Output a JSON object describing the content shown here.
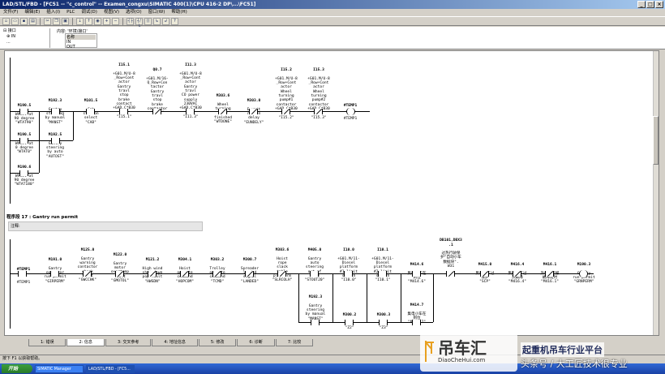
{
  "window": {
    "title": "LAD/STL/FBD - [FC51 -- \"c_control\" -- Examen_congxu\\SIMATIC 400(1)\\CPU 416-2 DP\\...\\FC51]",
    "min_label": "_",
    "max_label": "□",
    "close_label": "×"
  },
  "menu": [
    "文件(F)",
    "编辑(E)",
    "插入(I)",
    "PLC",
    "调试(D)",
    "视图(V)",
    "选项(O)",
    "窗口(W)",
    "帮助(H)"
  ],
  "declaration": {
    "tree_root": "⊟ 接口",
    "tree_in": "⊕ IN",
    "tree_more": "...",
    "path_label": "内容: '环境\\接口'",
    "name_header": "名称",
    "name_value": "IN\nOUT"
  },
  "segment16": {
    "operands": [
      {
        "addr": "M190.5",
        "text": "Wheel at\n90 degree\n\"WTAT90\""
      },
      {
        "addr": "M192.3",
        "text": "Gantry\nsteering\nby manual\n\"MANST\""
      },
      {
        "addr": "M101.5",
        "text": "Cab\nstation\nselect\n\"CAB\""
      },
      {
        "addr": "I15.1",
        "text": "+G01.M/U-8\n_Row+Cont\nactor\nGantry\ntravl\nstop\nbrake\ncontact\n+GAD.C*B30\n48\n\"I15.1\""
      },
      {
        "addr": "Q0.7",
        "text": "+G01.M/16-\nQ_Row+Con\ntactor\nGantry\ntravl\nstop\nbrake\ncontactor\n\"Q0.7\""
      },
      {
        "addr": "I11.3",
        "text": "+G01.M/U-8\n_Row+Cont\nactor\nGantry\ntravl\nCO power\nsupply\n230VAC\n+GAD.C*B30\n8\n\"I11.3\""
      },
      {
        "addr": "M303.6",
        "text": "Wheel\nturning\ntime\nfinished\n\"WTDONE\""
      },
      {
        "addr": "M303.0",
        "text": "E_unit\nrun on\ndelay\n\"EUNDELY\""
      },
      {
        "addr": "I15.2",
        "text": "+G01.M/U-8\n_Row+Cont\nactor\nWheel\nturning\npump#1\ncontactor\n+GAD.C*B30\n1\n\"I15.2\""
      },
      {
        "addr": "I15.3",
        "text": "+G01.M/U-8\n_Row+Cont\nactor\nWheel\nturning\npump#2\ncontactor\n+GAD.C*B30\n2\n\"I15.3\""
      },
      {
        "addr": "#TEMP1",
        "text": "\n#TEMP1"
      }
    ],
    "branch1": {
      "addr": "M190.5",
      "text": "Wheel at\n0 degree\n\"WTAT0\""
    },
    "branch1b": {
      "addr": "M192.5",
      "text": "Gantry\nsteering\nby auto\n\"AUTOST\""
    },
    "branch2": {
      "addr": "M190.6",
      "text": "Wheel at\n90 degree\n\"WTAT180\""
    }
  },
  "segment17": {
    "title": "程序段 17 : Gantry run permit",
    "comment": "注释:",
    "operands": [
      {
        "addr": "#TEMP1",
        "text": "\n#TEMP1"
      },
      {
        "addr": "M191.0",
        "text": "Gantry\noperator\nrun permit\n\"GIRPERM\""
      },
      {
        "addr": "M125.0",
        "text": "Gantry\nwarning\ncontactor\ncheck\nfault\n\"GWCCHK\""
      },
      {
        "addr": "M122.0",
        "text": "Gantry\nmotor\novertemp\nfault\n\"GMOTOL\""
      },
      {
        "addr": "M121.2",
        "text": "High wind\nshut down\npop fault\n\"HWSDN\""
      },
      {
        "addr": "M304.1",
        "text": "Hoist\noperate\ncommand\n\"HOPCOM\""
      },
      {
        "addr": "M303.2",
        "text": "Trolley\noperate\ncommand\n\"TCMD\""
      },
      {
        "addr": "M300.7",
        "text": "Spreader\nlanded\nsignal\n\"LANDED\""
      },
      {
        "addr": "M303.6",
        "text": "Hoist\nrope\nslack\ntable\nplatform\n\"SLRCOLH\""
      },
      {
        "addr": "M405.0",
        "text": "Gantry\nauto\nsteering\nout of\n20CM\n\"STOUT20\""
      },
      {
        "addr": "I10.0",
        "text": "+G01.M/11-\nDiesel\nplatform\n#1 limit\nswitch\n\"I10.0\""
      },
      {
        "addr": "I10.1",
        "text": "+G01.M/11-\nDiesel\nplatform\n#2 limit\nswitch\n\"I10.1\""
      },
      {
        "addr": "M414.6",
        "text": "集电小车在\n到位\n\"M414.6\""
      },
      {
        "addr": "DB101,DBX3\n.1",
        "text": "过热行驶保\n护\"自动小车\n数据块\".\nW31"
      },
      {
        "addr": "M415.0",
        "text": "集电小车过\n保护\n\"SCP\""
      },
      {
        "addr": "M416.4",
        "text": "集电小车过\n热故障\n\"M416.4\""
      },
      {
        "addr": "M416.1",
        "text": "外电运行报\n故障延时\n\"M416.1\""
      },
      {
        "addr": "M190.3",
        "text": "Gantry\nrun permit\n\"GRNPERM\""
      }
    ],
    "branchA": {
      "addr": "M192.3",
      "text": "Gantry\nsteering\nby manual\n\"MANST\""
    },
    "branchB": {
      "addr": "M300.2",
      "text": "\n\"Z2\""
    },
    "branchC": {
      "addr": "M300.3",
      "text": "\n\"Z3\""
    },
    "branchD": {
      "addr": "M414.7",
      "text": "集电小车在\n到位\n\"M414.7\""
    }
  },
  "bottom_tabs": [
    "1: 错误",
    "2: 信息",
    "3: 交叉参考",
    "4: 地址信息",
    "5: 修改",
    "6: 诊断",
    "7: 比较"
  ],
  "status": "按下 F1 以获取帮助。",
  "taskbar": {
    "start": "开始",
    "tasks": [
      "SIMATIC Manager",
      "LAD/STL/FBD - [FC5..."
    ]
  },
  "watermark": {
    "brand": "吊车汇",
    "url": "DiaoCheHui.com",
    "slogan": "起重机吊车行业平台",
    "sub": "头条号 / 大工匠技术很专业"
  },
  "colors": {
    "title_start": "#0a246a",
    "title_end": "#a6caf0",
    "taskbar": "#245edb",
    "start": "#3c9e3c"
  }
}
